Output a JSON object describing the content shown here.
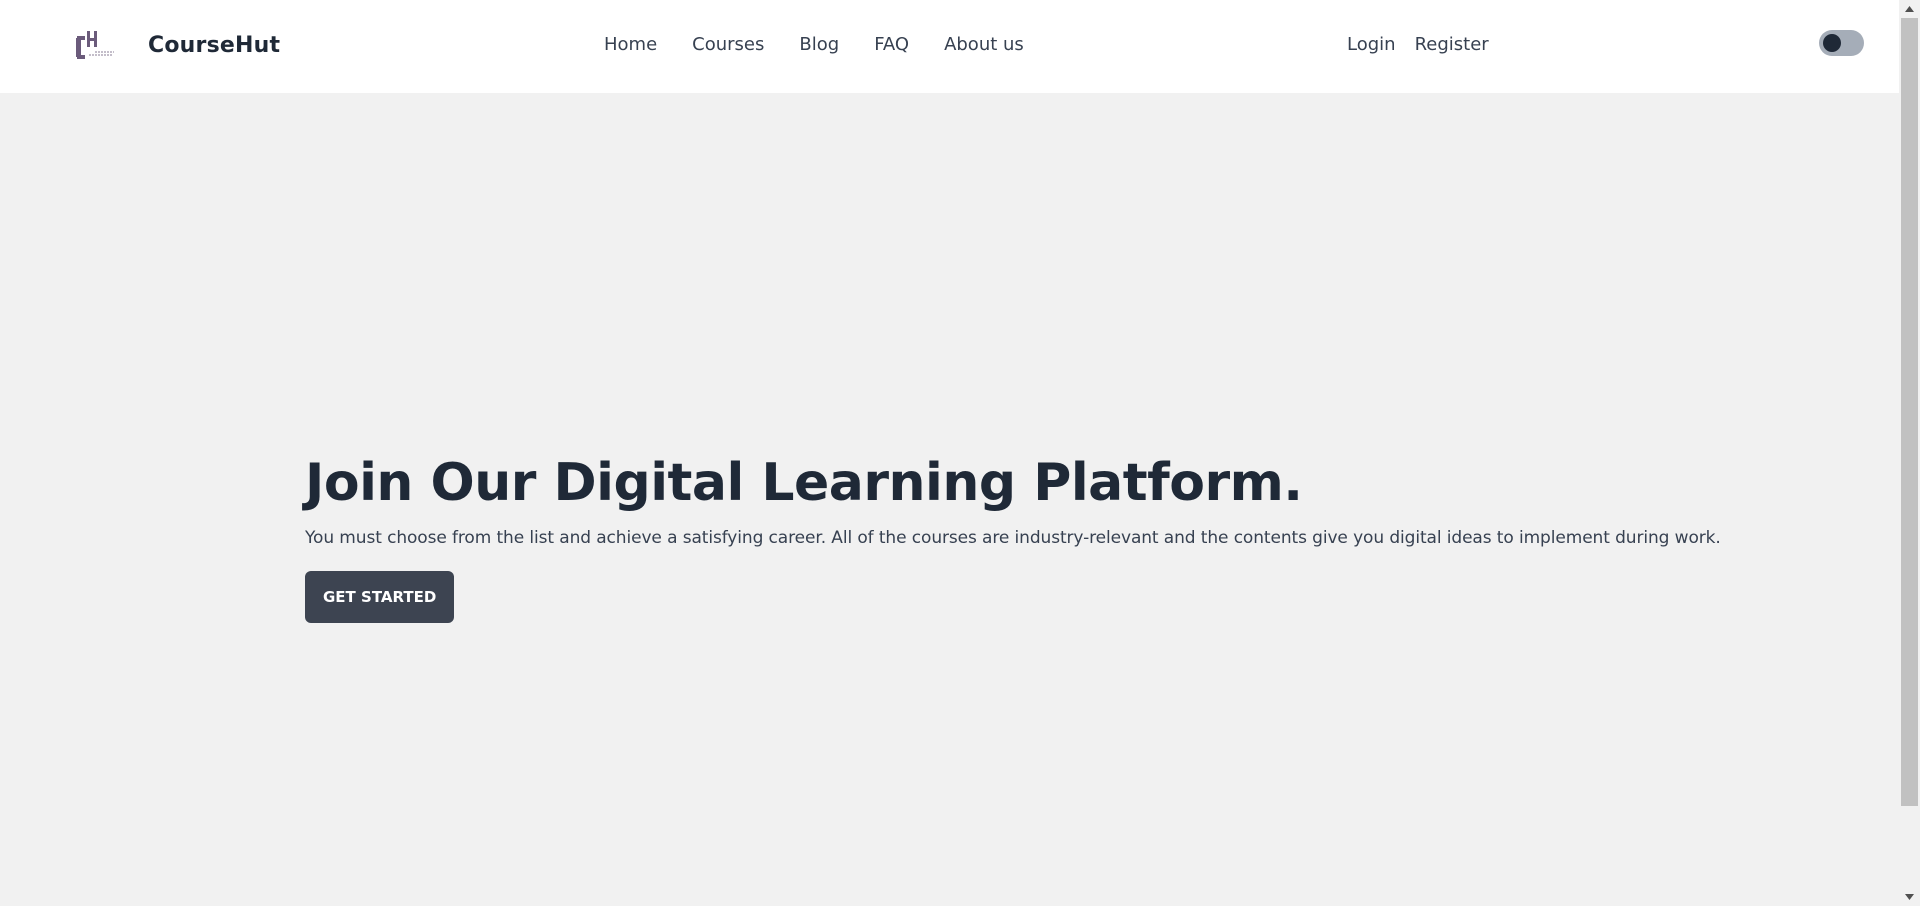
{
  "header": {
    "brand_name": "CourseHut",
    "logo_icon": "coursehut-logo-icon",
    "nav": [
      {
        "label": "Home"
      },
      {
        "label": "Courses"
      },
      {
        "label": "Blog"
      },
      {
        "label": "FAQ"
      },
      {
        "label": "About us"
      }
    ],
    "auth": {
      "login_label": "Login",
      "register_label": "Register"
    },
    "theme_toggle": {
      "icon": "theme-toggle-icon",
      "state": "off"
    }
  },
  "hero": {
    "title": "Join Our Digital Learning Platform.",
    "description": "You must choose from the list and achieve a satisfying career. All of the courses are industry-relevant and the contents give you digital ideas to implement during work.",
    "cta_label": "GET STARTED"
  },
  "colors": {
    "background": "#f1f1f1",
    "header": "#ffffff",
    "text_dark": "#1f2937",
    "button": "#3d4451",
    "toggle_track": "#a5adb8"
  }
}
